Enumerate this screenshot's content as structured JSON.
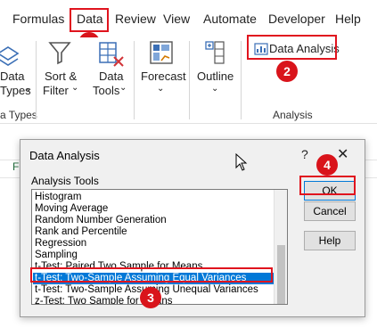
{
  "ribbon_tabs": [
    "Formulas",
    "Data",
    "Review",
    "View",
    "Automate",
    "Developer",
    "Help"
  ],
  "ribbon": {
    "data_types_label_1": "Data",
    "data_types_label_2": "Types",
    "data_types_group": "a Types",
    "sort_filter_1": "Sort &",
    "sort_filter_2": "Filter",
    "data_tools_1": "Data",
    "data_tools_2": "Tools",
    "forecast": "Forecast",
    "outline": "Outline",
    "data_analysis": "Data Analysis",
    "analysis_group": "Analysis"
  },
  "sheet": {
    "partial_cell": "F"
  },
  "dialog": {
    "title": "Data Analysis",
    "help_glyph": "?",
    "close_glyph": "✕",
    "list_label": "Analysis Tools",
    "tools": [
      "Histogram",
      "Moving Average",
      "Random Number Generation",
      "Rank and Percentile",
      "Regression",
      "Sampling",
      "t-Test: Paired Two Sample for Means",
      "t-Test: Two-Sample Assuming Equal Variances",
      "t-Test: Two-Sample Assuming Unequal Variances",
      "z-Test: Two Sample for Means"
    ],
    "selected_index": 7,
    "buttons": {
      "ok": "OK",
      "cancel": "Cancel",
      "help": "Help"
    }
  },
  "badges": [
    "1",
    "2",
    "3",
    "4"
  ],
  "colors": {
    "highlight": "#e0141e",
    "badge": "#d9141b",
    "selection": "#0078d7"
  }
}
